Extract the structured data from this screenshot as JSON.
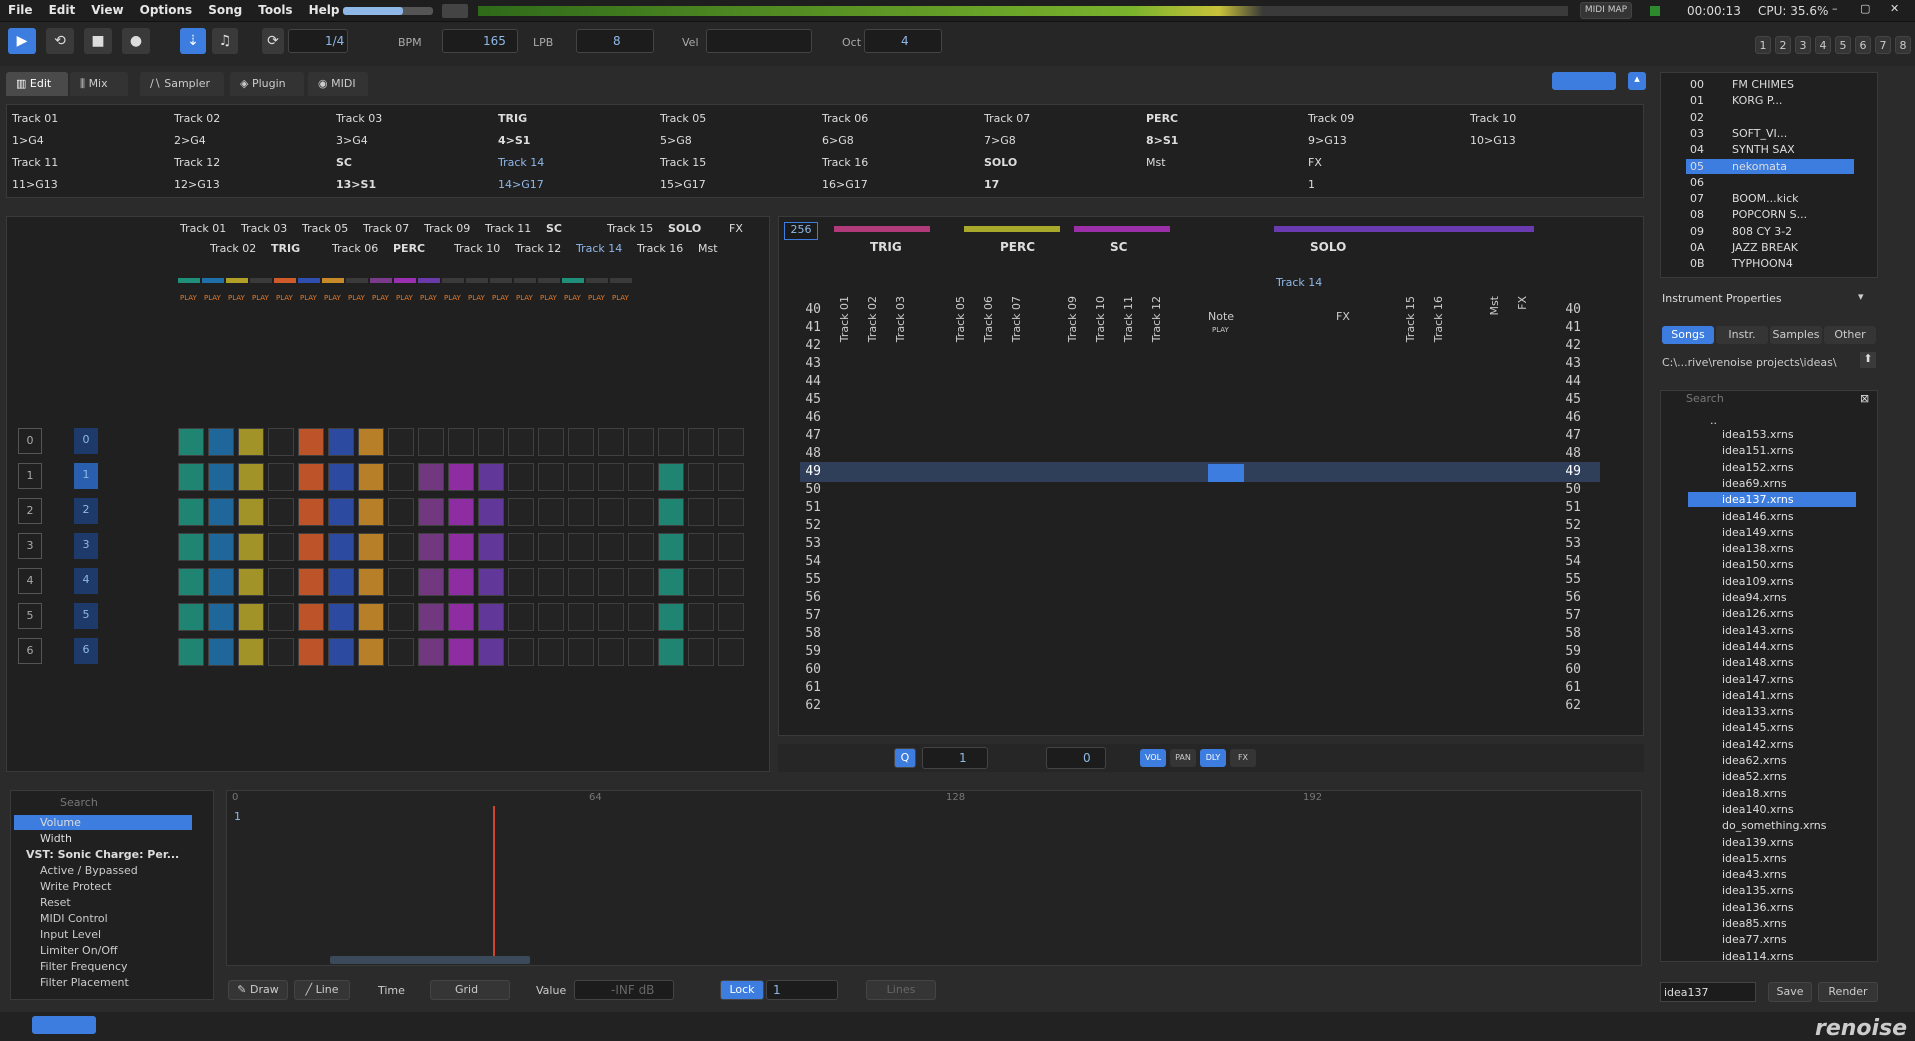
{
  "menu": [
    "File",
    "Edit",
    "View",
    "Options",
    "Song",
    "Tools",
    "Help"
  ],
  "status": {
    "midi_map": "MIDI MAP",
    "time": "00:00:13",
    "cpu": "CPU: 35.6%"
  },
  "transport": {
    "pattern_pos": "1/4",
    "bpm_label": "BPM",
    "bpm": "165",
    "lpb_label": "LPB",
    "lpb": "8",
    "vel_label": "Vel",
    "oct_label": "Oct",
    "oct": "4"
  },
  "view_buttons": [
    "1",
    "2",
    "3",
    "4",
    "5",
    "6",
    "7",
    "8"
  ],
  "tabs": {
    "edit": "Edit",
    "mix": "Mix",
    "sampler": "Sampler",
    "plugin": "Plugin",
    "midi": "MIDI"
  },
  "sequencer": {
    "row1": [
      {
        "name": "Track 01",
        "info": "1>G4",
        "bold": false
      },
      {
        "name": "Track 02",
        "info": "2>G4",
        "bold": false
      },
      {
        "name": "Track 03",
        "info": "3>G4",
        "bold": false
      },
      {
        "name": "TRIG",
        "info": "4>S1",
        "bold": true
      },
      {
        "name": "Track 05",
        "info": "5>G8",
        "bold": false
      },
      {
        "name": "Track 06",
        "info": "6>G8",
        "bold": false
      },
      {
        "name": "Track 07",
        "info": "7>G8",
        "bold": false
      },
      {
        "name": "PERC",
        "info": "8>S1",
        "bold": true
      },
      {
        "name": "Track 09",
        "info": "9>G13",
        "bold": false
      },
      {
        "name": "Track 10",
        "info": "10>G13",
        "bold": false
      }
    ],
    "row2": [
      {
        "name": "Track 11",
        "info": "11>G13",
        "bold": false
      },
      {
        "name": "Track 12",
        "info": "12>G13",
        "bold": false
      },
      {
        "name": "SC",
        "info": "13>S1",
        "bold": true
      },
      {
        "name": "Track 14",
        "info": "14>G17",
        "bold": false
      },
      {
        "name": "Track 15",
        "info": "15>G17",
        "bold": false
      },
      {
        "name": "Track 16",
        "info": "16>G17",
        "bold": false
      },
      {
        "name": "SOLO",
        "info": "17",
        "bold": true
      },
      {
        "name": "Mst",
        "info": "",
        "bold": false
      },
      {
        "name": "FX",
        "info": "1",
        "bold": false
      }
    ]
  },
  "matrix": {
    "headers_top": [
      "Track 01",
      "Track 03",
      "Track 05",
      "Track 07",
      "Track 09",
      "Track 11",
      "SC",
      "Track 15",
      "SOLO",
      "FX"
    ],
    "headers_bottom": [
      "Track 02",
      "TRIG",
      "Track 06",
      "PERC",
      "Track 10",
      "Track 12",
      "Track 14",
      "Track 16",
      "Mst"
    ],
    "play": "PLAY",
    "rows": [
      "0",
      "1",
      "2",
      "3",
      "4",
      "5",
      "6"
    ]
  },
  "pattern": {
    "lines_label": "256",
    "groups": [
      "TRIG",
      "PERC",
      "SC",
      "SOLO"
    ],
    "tracks": [
      "Track 01",
      "Track 02",
      "Track 03",
      "Track 05",
      "Track 06",
      "Track 07",
      "Track 09",
      "Track 10",
      "Track 11",
      "Track 12",
      "Track 15",
      "Track 16",
      "Mst",
      "FX"
    ],
    "selected_track": "Track 14",
    "note_label": "Note",
    "fx_label": "FX",
    "play_small": "PLAY",
    "rows": [
      "40",
      "41",
      "42",
      "43",
      "44",
      "45",
      "46",
      "47",
      "48",
      "49",
      "50",
      "51",
      "52",
      "53",
      "54",
      "55",
      "56",
      "57",
      "58",
      "59",
      "60",
      "61",
      "62"
    ],
    "current_row": "49",
    "step": "1",
    "edit_step": "0",
    "toggles": [
      "VOL",
      "PAN",
      "DLY",
      "FX"
    ]
  },
  "instruments": [
    {
      "id": "00",
      "name": "FM CHIMES"
    },
    {
      "id": "01",
      "name": "KORG P..."
    },
    {
      "id": "02",
      "name": ""
    },
    {
      "id": "03",
      "name": "SOFT_VI..."
    },
    {
      "id": "04",
      "name": "SYNTH SAX"
    },
    {
      "id": "05",
      "name": "nekomata"
    },
    {
      "id": "06",
      "name": ""
    },
    {
      "id": "07",
      "name": "BOOM...kick"
    },
    {
      "id": "08",
      "name": "POPCORN S..."
    },
    {
      "id": "09",
      "name": "808 CY 3-2"
    },
    {
      "id": "0A",
      "name": "JAZZ BREAK"
    },
    {
      "id": "0B",
      "name": "TYPHOON4"
    }
  ],
  "instrument_props": "Instrument Properties",
  "browser": {
    "tabs": [
      "Songs",
      "Instr.",
      "Samples",
      "Other"
    ],
    "path": "C:\\...rive\\renoise projects\\ideas\\",
    "search_placeholder": "Search",
    "parent": "..",
    "files": [
      "idea153.xrns",
      "idea151.xrns",
      "idea152.xrns",
      "idea69.xrns",
      "idea137.xrns",
      "idea146.xrns",
      "idea149.xrns",
      "idea138.xrns",
      "idea150.xrns",
      "idea109.xrns",
      "idea94.xrns",
      "idea126.xrns",
      "idea143.xrns",
      "idea144.xrns",
      "idea148.xrns",
      "idea147.xrns",
      "idea141.xrns",
      "idea133.xrns",
      "idea145.xrns",
      "idea142.xrns",
      "idea62.xrns",
      "idea52.xrns",
      "idea18.xrns",
      "idea140.xrns",
      "do_something.xrns",
      "idea139.xrns",
      "idea15.xrns",
      "idea43.xrns",
      "idea135.xrns",
      "idea136.xrns",
      "idea85.xrns",
      "idea77.xrns",
      "idea114.xrns"
    ],
    "selected": "idea137.xrns",
    "filename": "idea137",
    "save": "Save",
    "render": "Render"
  },
  "automation": {
    "search_placeholder": "Search",
    "params": [
      "Volume",
      "Width"
    ],
    "plugin": "VST: Sonic Charge: Per...",
    "plugin_params": [
      "Active / Bypassed",
      "Write Protect",
      "Reset",
      "MIDI Control",
      "Input Level",
      "Limiter On/Off",
      "Filter Frequency",
      "Filter Placement"
    ],
    "ruler": [
      "0",
      "64",
      "128",
      "192"
    ],
    "row_label": "1",
    "draw": "Draw",
    "line": "Line",
    "time": "Time",
    "grid": "Grid",
    "value": "Value",
    "value_field": "-INF dB",
    "lock": "Lock",
    "lock_value": "1",
    "lines": "Lines"
  },
  "brand": "renoise",
  "colors": {
    "accent": "#4a90e2",
    "selected": "#3d7de0"
  }
}
